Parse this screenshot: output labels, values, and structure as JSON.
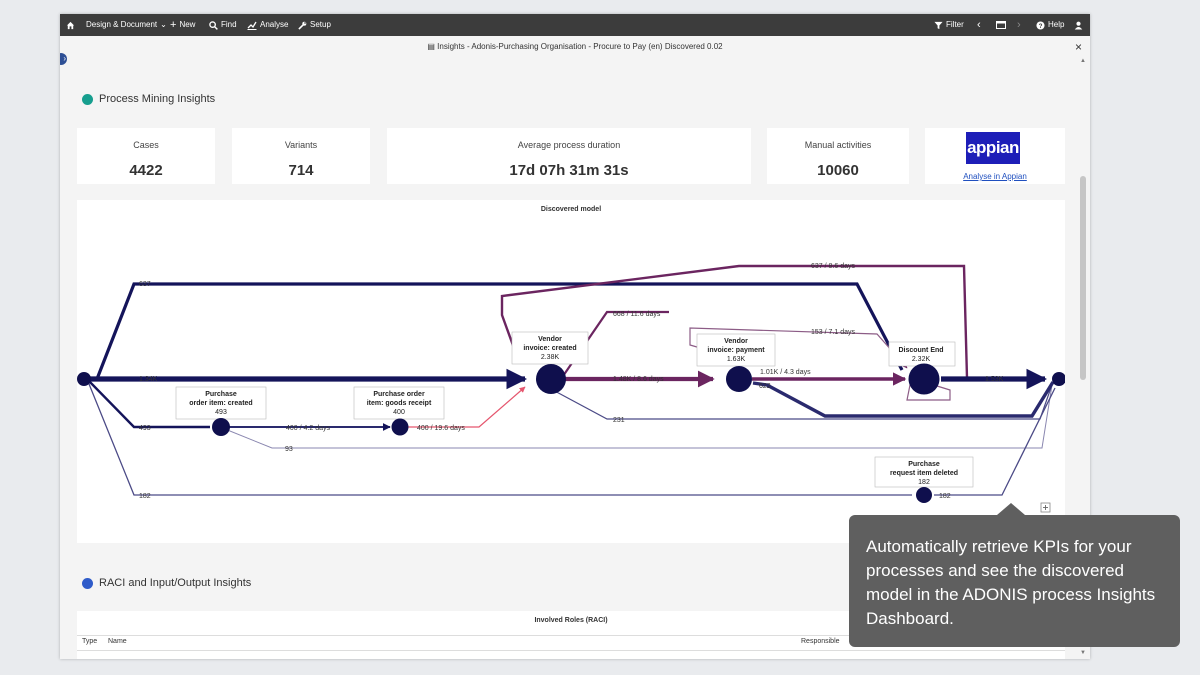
{
  "toolbar": {
    "design_document": "Design & Document",
    "new": "New",
    "find": "Find",
    "analyse": "Analyse",
    "setup": "Setup",
    "filter": "Filter",
    "help": "Help"
  },
  "window": {
    "title": "Insights - Adonis-Purchasing Organisation - Procure to Pay (en) Discovered 0.02",
    "close": "×"
  },
  "process_mining": {
    "heading": "Process Mining Insights",
    "dot_color": "#169e8e"
  },
  "kpis": {
    "cases_label": "Cases",
    "cases_value": "4422",
    "variants_label": "Variants",
    "variants_value": "714",
    "duration_label": "Average process duration",
    "duration_value": "17d 07h 31m 31s",
    "manual_label": "Manual activities",
    "manual_value": "10060"
  },
  "appian": {
    "logo_text": "appian",
    "link": "Analyse in Appian"
  },
  "model": {
    "title": "Discovered model",
    "nodes": {
      "po_created_l1": "Purchase",
      "po_created_l2": "order item: created",
      "po_created_count": "493",
      "goods_receipt_l1": "Purchase order",
      "goods_receipt_l2": "item: goods receipt",
      "goods_receipt_count": "400",
      "inv_created_l1": "Vendor",
      "inv_created_l2": "invoice: created",
      "inv_created_count": "2.38K",
      "inv_payment_l1": "Vendor",
      "inv_payment_l2": "invoice: payment",
      "inv_payment_count": "1.63K",
      "discount_end_l1": "Discount End",
      "discount_end_count": "2.32K",
      "pr_deleted_l1": "Purchase",
      "pr_deleted_l2": "request item deleted",
      "pr_deleted_count": "182"
    },
    "edges": {
      "e637": "637",
      "e134k": "1.34K",
      "e493": "493",
      "e182": "182",
      "e400_42": "400 / 4.2 days",
      "e400_196": "400 / 19.6 days",
      "e93": "93",
      "e148k": "1.48K / 8.6 days",
      "e668": "668 / 11.6 days",
      "e231": "231",
      "e637_86": "637 / 8.6 days",
      "e153": "153 / 7.1 days",
      "e101k": "1.01K / 4.3 days",
      "e622": "622",
      "e153k": "1.53K",
      "e182b": "182"
    }
  },
  "raci": {
    "heading": "RACI and Input/Output Insights",
    "dot_color": "#2e5bc9",
    "panel_title": "Involved Roles (RACI)",
    "col_type": "Type",
    "col_name": "Name",
    "col_responsible": "Responsible"
  },
  "tooltip": {
    "text": "Automatically retrieve KPIs for your processes and see the discovered model in the ADONIS process Insights Dashboard."
  }
}
